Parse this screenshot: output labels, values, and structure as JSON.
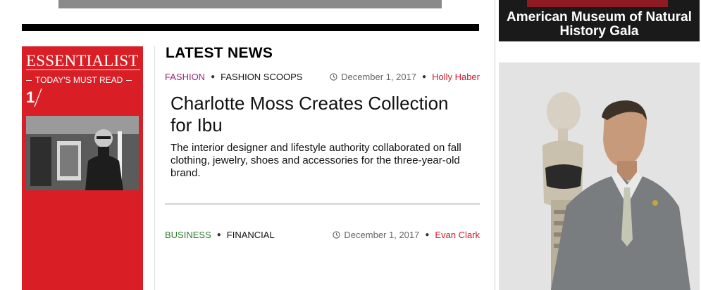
{
  "promo": {
    "title": "ESSENTIALIST",
    "subtitle": "TODAY'S MUST READ",
    "count": "1"
  },
  "latest": {
    "heading": "LATEST NEWS",
    "articles": [
      {
        "category": "FASHION",
        "subcategory": "FASHION SCOOPS",
        "date": "December 1, 2017",
        "author": "Holly Haber",
        "title": "Charlotte Moss Creates Collection for Ibu",
        "excerpt": "The interior designer and lifestyle authority collaborated on fall clothing, jewelry, shoes and accessories for the three-year-old brand."
      },
      {
        "category": "BUSINESS",
        "subcategory": "FINANCIAL",
        "date": "December 1, 2017",
        "author": "Evan Clark"
      }
    ]
  },
  "rail": {
    "gala_title": "American Museum of Natural History Gala"
  },
  "colors": {
    "promo_red": "#d91e26",
    "fashion": "#8f2a7a",
    "business": "#2f7d32",
    "author": "#d3192a"
  },
  "icons": [
    "clock-icon",
    "slash-icon"
  ]
}
